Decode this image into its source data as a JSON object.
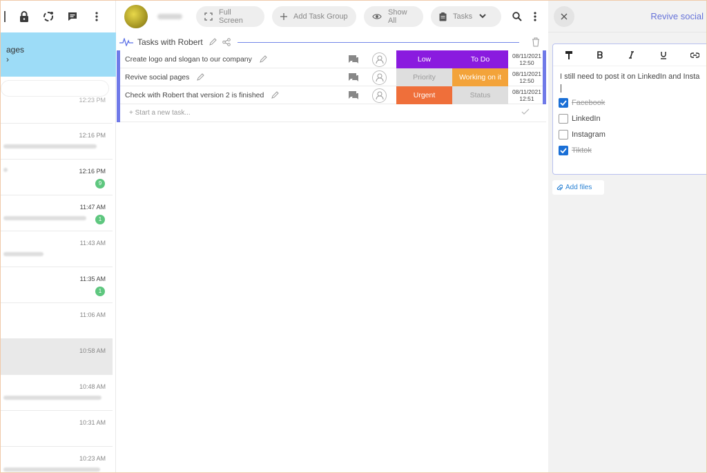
{
  "left": {
    "banner_line1": "ages",
    "banner_line2": "›",
    "first_time": "12:23 PM",
    "chats": [
      {
        "time": "12:16 PM",
        "badge": ""
      },
      {
        "time": "12:16 PM",
        "badge": "9"
      },
      {
        "time": "11:47 AM",
        "badge": "1"
      },
      {
        "time": "11:43 AM",
        "badge": ""
      },
      {
        "time": "11:35 AM",
        "badge": "1"
      },
      {
        "time": "11:06 AM",
        "badge": ""
      },
      {
        "time": "10:58 AM",
        "badge": ""
      },
      {
        "time": "10:48 AM",
        "badge": ""
      },
      {
        "time": "10:31 AM",
        "badge": ""
      },
      {
        "time": "10:23 AM",
        "badge": ""
      }
    ]
  },
  "toolbar": {
    "full_screen": "Full Screen",
    "add_task_group": "Add Task Group",
    "show_all": "Show All",
    "tasks": "Tasks"
  },
  "group": {
    "title": "Tasks with Robert"
  },
  "tasks": [
    {
      "name": "Create logo and slogan to our company",
      "priority": "Low",
      "priority_color": "#8a1bdf",
      "status": "To Do",
      "status_color": "#8a1bdf",
      "date": "08/11/2021",
      "time": "12:50"
    },
    {
      "name": "Revive social pages",
      "priority": "Priority",
      "priority_color": "#dedede",
      "status": "Working on it",
      "status_color": "#f3a33a",
      "date": "08/11/2021",
      "time": "12:50"
    },
    {
      "name": "Check with Robert that version 2 is finished",
      "priority": "Urgent",
      "priority_color": "#ef6f3a",
      "status": "Status",
      "status_color": "#dedede",
      "date": "08/11/2021",
      "time": "12:51"
    }
  ],
  "new_task_placeholder": "+ Start a new task...",
  "right": {
    "title": "Revive social",
    "note_text": "I still need to post it on LinkedIn and Insta",
    "checklist": [
      {
        "label": "Facebook",
        "checked": true
      },
      {
        "label": "LinkedIn",
        "checked": false
      },
      {
        "label": "Instagram",
        "checked": false
      },
      {
        "label": "Tiktok",
        "checked": true
      }
    ],
    "add_files": "Add files"
  },
  "colors": {
    "accent": "#6f79e8",
    "banner": "#9ddcf7",
    "badge": "#5ec77f",
    "link": "#2a82d4"
  }
}
